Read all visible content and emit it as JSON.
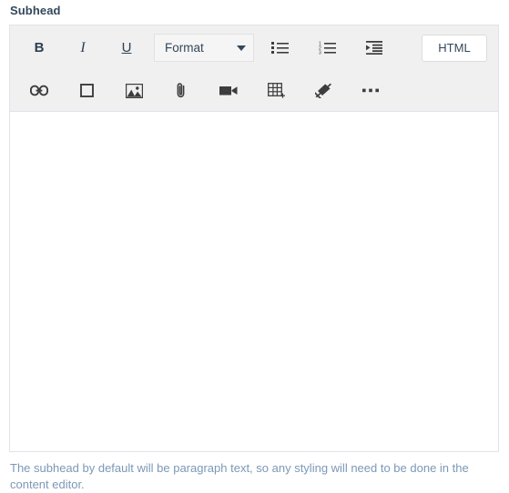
{
  "field": {
    "label": "Subhead",
    "help_text": "The subhead by default will be paragraph text, so any styling will need to be done in the content editor.",
    "editor_content": ""
  },
  "toolbar": {
    "row1": [
      {
        "name": "bold-icon",
        "label": "B"
      },
      {
        "name": "italic-icon",
        "label": "I"
      },
      {
        "name": "underline-icon",
        "label": "U"
      },
      {
        "name": "format-select",
        "label": "Format"
      },
      {
        "name": "bullet-list-icon",
        "label": ""
      },
      {
        "name": "numbered-list-icon",
        "label": ""
      },
      {
        "name": "indent-icon",
        "label": ""
      },
      {
        "name": "html-button",
        "label": "HTML"
      }
    ],
    "row2": [
      {
        "name": "link-icon",
        "label": ""
      },
      {
        "name": "anchor-icon",
        "label": ""
      },
      {
        "name": "image-icon",
        "label": ""
      },
      {
        "name": "attachment-icon",
        "label": ""
      },
      {
        "name": "video-icon",
        "label": ""
      },
      {
        "name": "table-icon",
        "label": ""
      },
      {
        "name": "remove-format-icon",
        "label": ""
      },
      {
        "name": "more-options-icon",
        "label": ""
      }
    ],
    "format_label": "Format",
    "html_label": "HTML",
    "bold_label": "B",
    "italic_label": "I",
    "underline_label": "U"
  },
  "colors": {
    "toolbar_bg": "#f0f0f0",
    "border": "#dfe3eb",
    "text": "#33475b",
    "help_text": "#7c98b6",
    "icon": "#3d3d3d",
    "editor_bg": "#ffffff"
  }
}
